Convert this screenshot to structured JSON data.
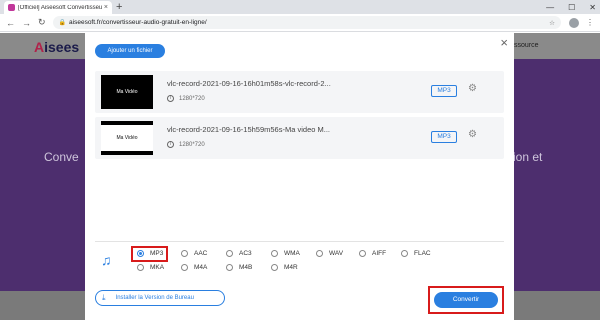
{
  "browser": {
    "tab_title": "[Officiel] Aiseesoft Convertisseu",
    "tab_close": "×",
    "new_tab": "+",
    "window_controls": [
      "—",
      "☐",
      "✕"
    ],
    "back": "←",
    "forward": "→",
    "reload": "↻",
    "url": "aiseesoft.fr/convertisseur-audio-gratuit-en-ligne/",
    "lock": "🔒",
    "bookmark": "☆",
    "menu": "⋮"
  },
  "site": {
    "logo_a": "A",
    "logo_rest": "isees",
    "nav_item": "ssource",
    "hero_left": "Conve",
    "hero_right": "ion et"
  },
  "modal": {
    "add_file": "Ajouter un fichier",
    "close": "×",
    "files": [
      {
        "thumb_text": "Ma Vidéo",
        "name": "vlc-record-2021-09-16-16h01m58s-vlc-record-2...",
        "resolution": "1280*720",
        "format": "MP3"
      },
      {
        "thumb_text": "Ma Vidéo",
        "name": "vlc-record-2021-09-16-15h59m56s-Ma video M...",
        "resolution": "1280*720",
        "format": "MP3"
      }
    ],
    "formats_row1": [
      "MP3",
      "AAC",
      "AC3",
      "WMA",
      "WAV",
      "AIFF",
      "FLAC"
    ],
    "formats_row2": [
      "MKA",
      "M4A",
      "M4B",
      "M4R"
    ],
    "selected_format": "MP3",
    "install_label": "Installer la Version de Bureau",
    "convert_label": "Convertir"
  },
  "colors": {
    "accent": "#2a7fe0",
    "highlight": "#d81b1b",
    "hero": "#4d2e6e"
  }
}
